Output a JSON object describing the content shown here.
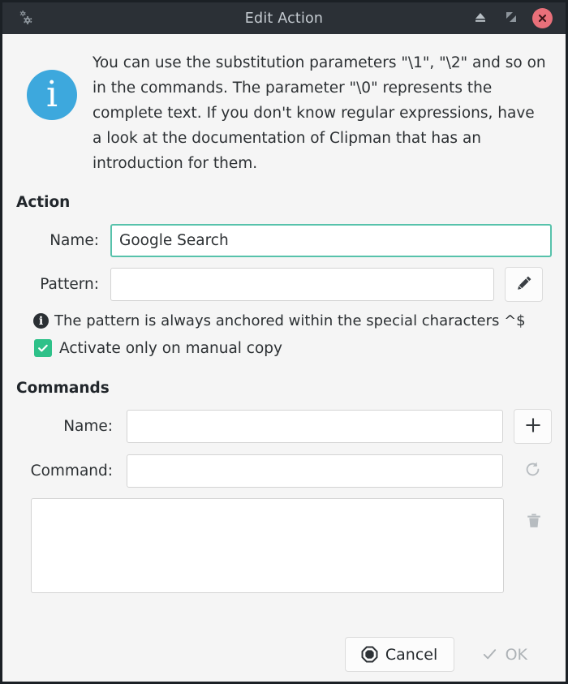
{
  "window": {
    "title": "Edit Action",
    "app_icon": "gears-icon",
    "controls": [
      {
        "name": "shade-button",
        "icon": "eject-icon"
      },
      {
        "name": "maximize-button",
        "icon": "maximize-icon"
      },
      {
        "name": "close-button",
        "icon": "close-icon"
      }
    ],
    "titlebar_bg": "#2b3036",
    "titlebar_fg": "#c6ccd2",
    "close_bg": "#e9707a"
  },
  "info": {
    "icon": "info-icon",
    "icon_color": "#3da8dd",
    "text": "You can use the substitution parameters \"\\1\", \"\\2\" and so on in the commands. The parameter \"\\0\" represents the complete text. If you don't know regular expressions, have a look at the documentation of Clipman that has an introduction for them."
  },
  "action": {
    "heading": "Action",
    "name_label": "Name:",
    "name_value": "Google Search",
    "name_placeholder": "",
    "name_focused": true,
    "focus_border_color": "#57c2ab",
    "pattern_label": "Pattern:",
    "pattern_value": "",
    "pattern_placeholder": "",
    "edit_button_icon": "pencil-icon",
    "hint_icon": "info-icon",
    "hint_text": "The pattern is always anchored within the special characters ^$",
    "checkbox_label": "Activate only on manual copy",
    "checkbox_checked": true,
    "checkbox_color": "#2ec189"
  },
  "commands": {
    "heading": "Commands",
    "name_label": "Name:",
    "name_value": "",
    "name_placeholder": "",
    "command_label": "Command:",
    "command_value": "",
    "command_placeholder": "",
    "add_button_icon": "plus-icon",
    "refresh_button_icon": "refresh-icon",
    "refresh_enabled": false,
    "delete_button_icon": "trash-icon",
    "delete_enabled": false,
    "list_items": []
  },
  "footer": {
    "cancel_label": "Cancel",
    "cancel_icon": "stop-icon",
    "ok_label": "OK",
    "ok_icon": "check-icon",
    "ok_enabled": false
  }
}
